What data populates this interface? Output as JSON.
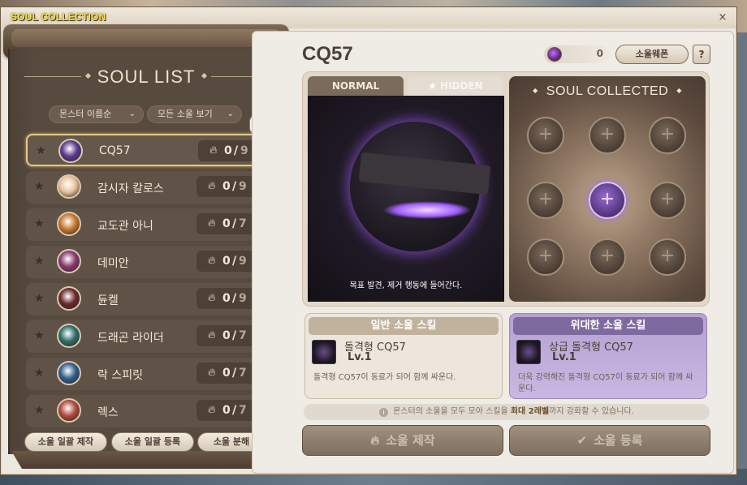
{
  "window": {
    "title": "SOUL COLLECTION",
    "close_glyph": "×"
  },
  "left": {
    "heading": "SOUL LIST",
    "sort_dropdown": "몬스터 이름순",
    "filter_dropdown": "모든 소울 보기",
    "items": [
      {
        "name": "CQ57",
        "got": "0",
        "total": "9",
        "selected": true,
        "avatar_color": "#5a3a8c"
      },
      {
        "name": "감시자 칼로스",
        "got": "0",
        "total": "9",
        "selected": false,
        "avatar_color": "#e9c39a"
      },
      {
        "name": "교도관 아니",
        "got": "0",
        "total": "7",
        "selected": false,
        "avatar_color": "#c8782e"
      },
      {
        "name": "데미안",
        "got": "0",
        "total": "9",
        "selected": false,
        "avatar_color": "#8a3a6e"
      },
      {
        "name": "듄켈",
        "got": "0",
        "total": "9",
        "selected": false,
        "avatar_color": "#6a2a2a"
      },
      {
        "name": "드래곤 라이더",
        "got": "0",
        "total": "7",
        "selected": false,
        "avatar_color": "#2f6f6a"
      },
      {
        "name": "락 스피릿",
        "got": "0",
        "total": "7",
        "selected": false,
        "avatar_color": "#2f5f8a"
      },
      {
        "name": "렉스",
        "got": "0",
        "total": "7",
        "selected": false,
        "avatar_color": "#b24a3a"
      }
    ],
    "buttons": {
      "batch_craft": "소울 일괄 제작",
      "batch_register": "소울 일괄 등록",
      "disassemble": "소울 분해"
    }
  },
  "right": {
    "monster_title": "CQ57",
    "coin_value": "0",
    "soul_weapon_btn": "소울웨폰",
    "help_btn": "?",
    "tabs": {
      "normal": "NORMAL",
      "hidden": "HIDDEN"
    },
    "art_caption": "목표 발견, 제거 행동에 들어간다.",
    "collected_header": "SOUL COLLECTED",
    "slot_glyph": "+",
    "slots": [
      "empty",
      "empty",
      "empty",
      "empty",
      "active",
      "empty",
      "empty",
      "empty",
      "empty"
    ],
    "skill_normal": {
      "header": "일반 소울 스킬",
      "name": "돌격형 CQ57",
      "level": "Lv.1",
      "desc": "돌격형 CQ57이 동료가 되어 함께 싸운다."
    },
    "skill_great": {
      "header": "위대한 소울 스킬",
      "name": "상급 돌격형 CQ57",
      "level": "Lv.1",
      "desc": "더욱 강력해진 돌격형 CQ57이 동료가 되어 함께 싸운다."
    },
    "notice_pre": "몬스터의 소울을 모두 모아 스킬을 ",
    "notice_em": "최대 2레벨",
    "notice_post": "까지 강화할 수 있습니다.",
    "craft_btn": "소울 제작",
    "register_btn": "소울 등록"
  }
}
